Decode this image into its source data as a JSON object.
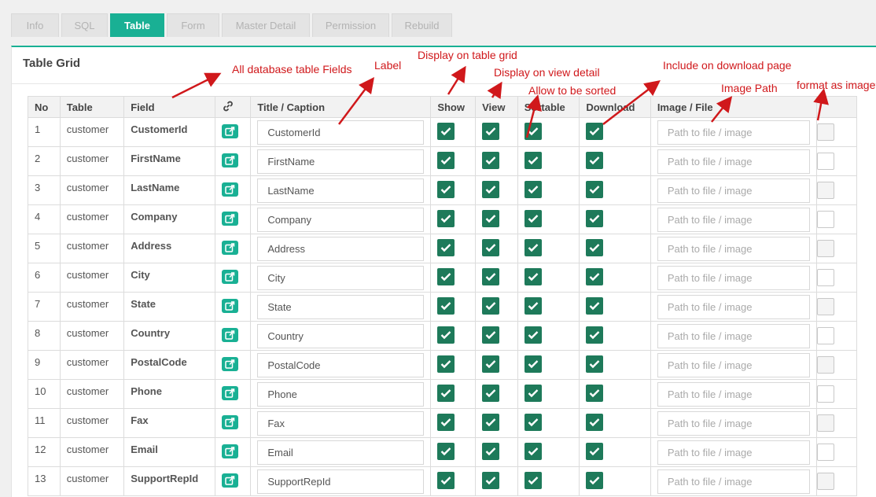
{
  "tabs": [
    {
      "label": "Info",
      "active": false
    },
    {
      "label": "SQL",
      "active": false
    },
    {
      "label": "Table",
      "active": true
    },
    {
      "label": "Form",
      "active": false
    },
    {
      "label": "Master Detail",
      "active": false
    },
    {
      "label": "Permission",
      "active": false
    },
    {
      "label": "Rebuild",
      "active": false
    }
  ],
  "panel": {
    "title": "Table Grid"
  },
  "columns": {
    "no": "No",
    "table": "Table",
    "field": "Field",
    "link": "link-icon",
    "title": "Title / Caption",
    "show": "Show",
    "view": "View",
    "sortable": "Sortable",
    "download": "Download",
    "image": "Image / File"
  },
  "image_placeholder": "Path to file / image",
  "rows": [
    {
      "no": "1",
      "table": "customer",
      "field": "CustomerId",
      "title": "CustomerId"
    },
    {
      "no": "2",
      "table": "customer",
      "field": "FirstName",
      "title": "FirstName"
    },
    {
      "no": "3",
      "table": "customer",
      "field": "LastName",
      "title": "LastName"
    },
    {
      "no": "4",
      "table": "customer",
      "field": "Company",
      "title": "Company"
    },
    {
      "no": "5",
      "table": "customer",
      "field": "Address",
      "title": "Address"
    },
    {
      "no": "6",
      "table": "customer",
      "field": "City",
      "title": "City"
    },
    {
      "no": "7",
      "table": "customer",
      "field": "State",
      "title": "State"
    },
    {
      "no": "8",
      "table": "customer",
      "field": "Country",
      "title": "Country"
    },
    {
      "no": "9",
      "table": "customer",
      "field": "PostalCode",
      "title": "PostalCode"
    },
    {
      "no": "10",
      "table": "customer",
      "field": "Phone",
      "title": "Phone"
    },
    {
      "no": "11",
      "table": "customer",
      "field": "Fax",
      "title": "Fax"
    },
    {
      "no": "12",
      "table": "customer",
      "field": "Email",
      "title": "Email"
    },
    {
      "no": "13",
      "table": "customer",
      "field": "SupportRepId",
      "title": "SupportRepId"
    }
  ],
  "annotations": {
    "fields": "All database table Fields",
    "label": "Label",
    "show": "Display on table grid",
    "view": "Display on view detail",
    "sorted": "Allow to be sorted",
    "download": "Include on download page",
    "image": "Image Path",
    "format": "format as image"
  },
  "colors": {
    "accent": "#19b094",
    "check": "#1e7a5a",
    "annotation": "#d0181b"
  }
}
